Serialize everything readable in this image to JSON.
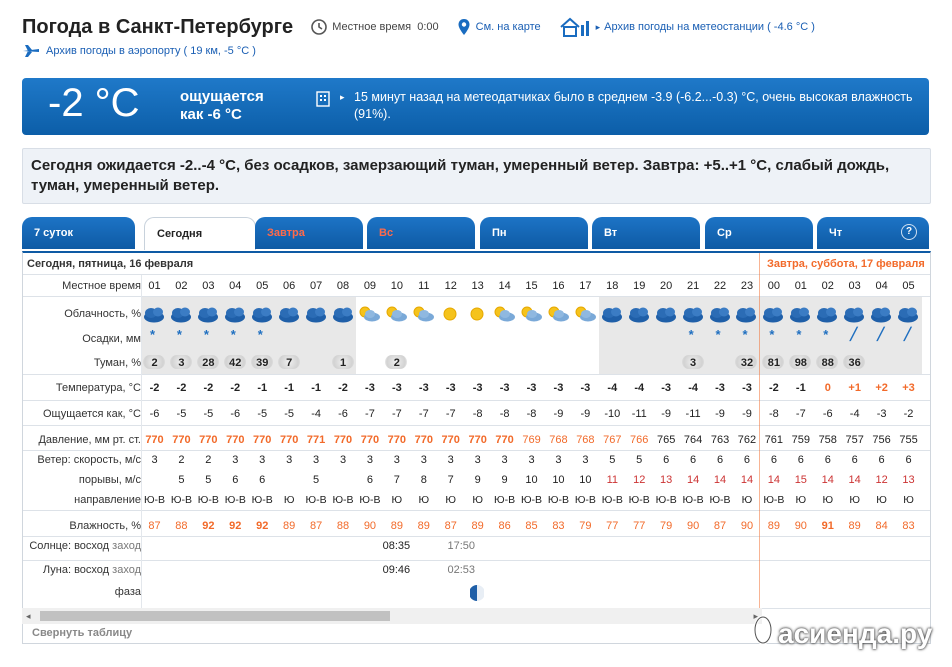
{
  "header": {
    "title": "Погода в Санкт-Петербурге",
    "local_time_label": "Местное время",
    "local_time_value": "0:00",
    "map_link": "См. на карте",
    "station_archive": "Архив погоды на метеостанции ( -4.6 °C )",
    "airport_archive": "Архив погоды в аэропорту ( 19 км, -5 °C )"
  },
  "now": {
    "temp": "-2 °C",
    "feels_line1": "ощущается",
    "feels_line2": "как -6 °C",
    "bullet": "▸",
    "message": "15 минут назад на метеодатчиках было в среднем -3.9 (-6.2...-0.3) °C, очень высокая влажность (91%)."
  },
  "today_summary": "Сегодня ожидается -2..-4 °C, без осадков, замерзающий туман, умеренный ветер. Завтра: +5..+1 °C, слабый дождь, туман, умеренный ветер.",
  "tabs": [
    {
      "label": "7 суток",
      "red": false,
      "active": false
    },
    {
      "label": "Сегодня",
      "red": false,
      "active": true
    },
    {
      "label": "Завтра",
      "red": true,
      "active": false
    },
    {
      "label": "Вс",
      "red": true,
      "active": false
    },
    {
      "label": "Пн",
      "red": false,
      "active": false
    },
    {
      "label": "Вт",
      "red": false,
      "active": false
    },
    {
      "label": "Ср",
      "red": false,
      "active": false
    },
    {
      "label": "Чт",
      "red": false,
      "active": false
    }
  ],
  "help": "?",
  "days": {
    "today": "Сегодня, пятница, 16 февраля",
    "tomorrow": "Завтра, суббота, 17 февраля"
  },
  "labels": {
    "local_time": "Местное время",
    "cloud": "Облачность, %",
    "precip": "Осадки, мм",
    "fog": "Туман, %",
    "temp": "Температура, °C",
    "feels": "Ощущается как, °C",
    "pressure": "Давление, мм рт. ст.",
    "wind": "Ветер: скорость, м/с",
    "gusts": "порывы, м/с",
    "direction": "направление",
    "humidity": "Влажность, %",
    "sun_prefix": "Солнце:",
    "sun_rise": "восход",
    "sun_set": "заход",
    "moon_prefix": "Луна:",
    "moon_rise": "восход",
    "moon_set": "заход",
    "phase": "фаза"
  },
  "hours": [
    "01",
    "02",
    "03",
    "04",
    "05",
    "06",
    "07",
    "08",
    "09",
    "10",
    "11",
    "12",
    "13",
    "14",
    "15",
    "16",
    "17",
    "18",
    "19",
    "20",
    "21",
    "22",
    "23",
    "00",
    "01",
    "02",
    "03",
    "04",
    "05"
  ],
  "cloud_icons": [
    "cloud",
    "cloud",
    "cloud",
    "cloud",
    "cloud",
    "cloud",
    "cloud",
    "cloud",
    "sun-cloud",
    "sun-cloud",
    "sun-cloud",
    "sun",
    "sun",
    "sun-cloud",
    "sun-cloud",
    "sun-cloud",
    "sun-cloud",
    "cloud",
    "cloud",
    "cloud",
    "cloud",
    "cloud",
    "cloud",
    "cloud",
    "cloud",
    "cloud",
    "cloud",
    "cloud",
    "cloud"
  ],
  "precip_icons": [
    "snow",
    "snow",
    "snow",
    "snow",
    "snow",
    "",
    "",
    "",
    "",
    "",
    "",
    "",
    "",
    "",
    "",
    "",
    "",
    "",
    "",
    "",
    "snow",
    "snow",
    "snow",
    "snow",
    "snow",
    "snow",
    "rain",
    "rain",
    "rain"
  ],
  "fog": [
    "2",
    "3",
    "28",
    "42",
    "39",
    "7",
    "",
    "1",
    "",
    "2",
    "",
    "",
    "",
    "",
    "",
    "",
    "",
    "",
    "",
    "",
    "3",
    "",
    "32",
    "81",
    "98",
    "88",
    "36",
    "",
    ""
  ],
  "temp": [
    "-2",
    "-2",
    "-2",
    "-2",
    "-1",
    "-1",
    "-1",
    "-2",
    "-3",
    "-3",
    "-3",
    "-3",
    "-3",
    "-3",
    "-3",
    "-3",
    "-3",
    "-4",
    "-4",
    "-3",
    "-4",
    "-3",
    "-3",
    "-2",
    "-1",
    "0",
    "+1",
    "+2",
    "+3"
  ],
  "feels": [
    "-6",
    "-5",
    "-5",
    "-6",
    "-5",
    "-5",
    "-4",
    "-6",
    "-7",
    "-7",
    "-7",
    "-7",
    "-8",
    "-8",
    "-8",
    "-9",
    "-9",
    "-10",
    "-11",
    "-9",
    "-11",
    "-9",
    "-9",
    "-8",
    "-7",
    "-6",
    "-4",
    "-3",
    "-2"
  ],
  "pressure": [
    "770",
    "770",
    "770",
    "770",
    "770",
    "770",
    "771",
    "770",
    "770",
    "770",
    "770",
    "770",
    "770",
    "770",
    "769",
    "768",
    "768",
    "767",
    "766",
    "765",
    "764",
    "763",
    "762",
    "761",
    "759",
    "758",
    "757",
    "756",
    "755"
  ],
  "wind": [
    "3",
    "2",
    "2",
    "3",
    "3",
    "3",
    "3",
    "3",
    "3",
    "3",
    "3",
    "3",
    "3",
    "3",
    "3",
    "3",
    "3",
    "5",
    "5",
    "6",
    "6",
    "6",
    "6",
    "6",
    "6",
    "6",
    "6",
    "6",
    "6"
  ],
  "gusts": [
    "",
    "5",
    "5",
    "6",
    "6",
    "",
    "5",
    "",
    "6",
    "7",
    "8",
    "7",
    "9",
    "9",
    "10",
    "10",
    "10",
    "11",
    "12",
    "13",
    "14",
    "14",
    "14",
    "14",
    "15",
    "14",
    "14",
    "12",
    "13"
  ],
  "direction": [
    "Ю-В",
    "Ю-В",
    "Ю-В",
    "Ю-В",
    "Ю-В",
    "Ю",
    "Ю-В",
    "Ю-В",
    "Ю-В",
    "Ю",
    "Ю",
    "Ю",
    "Ю",
    "Ю-В",
    "Ю-В",
    "Ю-В",
    "Ю-В",
    "Ю-В",
    "Ю-В",
    "Ю-В",
    "Ю-В",
    "Ю-В",
    "Ю",
    "Ю-В",
    "Ю",
    "Ю",
    "Ю",
    "Ю",
    "Ю"
  ],
  "humidity": [
    "87",
    "88",
    "92",
    "92",
    "92",
    "89",
    "87",
    "88",
    "90",
    "89",
    "89",
    "87",
    "89",
    "86",
    "85",
    "83",
    "79",
    "77",
    "77",
    "79",
    "90",
    "87",
    "90",
    "89",
    "90",
    "91",
    "89",
    "84",
    "83"
  ],
  "sun": {
    "rise": "08:35",
    "set": "17:50"
  },
  "moon": {
    "rise": "09:46",
    "set": "02:53"
  },
  "footer": {
    "collapse": "Свернуть таблицу",
    "watermark": "асиенда.ру"
  },
  "colors": {
    "blue": "#1a6cc0",
    "red": "#f26a2a"
  }
}
